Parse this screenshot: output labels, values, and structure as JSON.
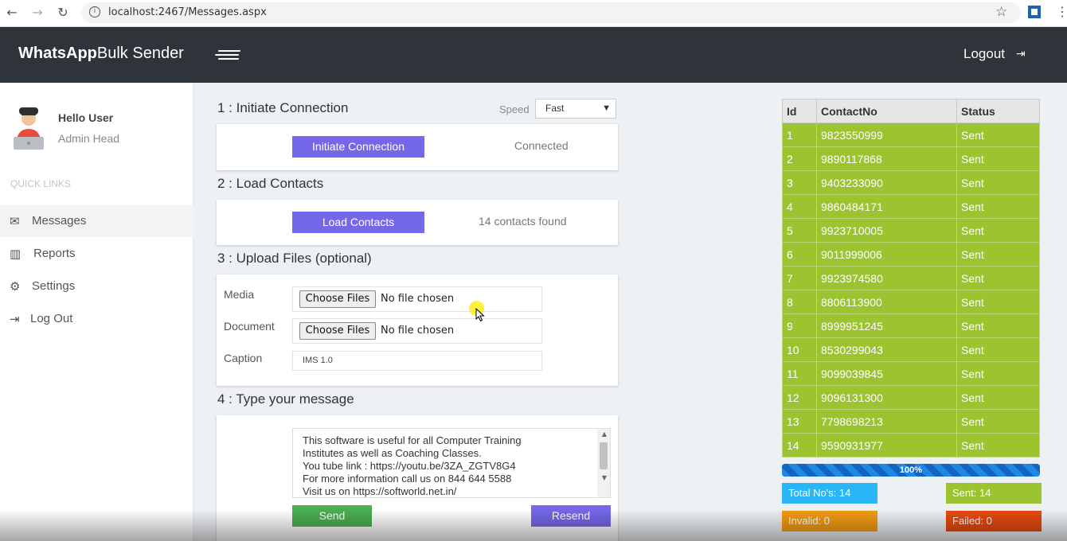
{
  "browser": {
    "url": "localhost:2467/Messages.aspx",
    "back_icon": "←",
    "forward_icon": "→",
    "reload_icon": "↻",
    "info_icon": "i",
    "star_icon": "☆",
    "kebab_icon": "⋮"
  },
  "header": {
    "brand_bold": "WhatsApp",
    "brand_rest": "Bulk Sender",
    "logout_label": "Logout",
    "logout_icon": "⇥"
  },
  "sidebar": {
    "greeting": "Hello User",
    "role": "Admin Head",
    "quick_links_label": "QUICK LINKS",
    "items": [
      {
        "label": "Messages",
        "icon": "✉"
      },
      {
        "label": "Reports",
        "icon": "▥"
      },
      {
        "label": "Settings",
        "icon": "⚙"
      },
      {
        "label": "Log Out",
        "icon": "⇥"
      }
    ]
  },
  "step1": {
    "title": "1 : Initiate Connection",
    "speed_label": "Speed",
    "speed_value": "Fast",
    "button_label": "Initiate Connection",
    "status": "Connected"
  },
  "step2": {
    "title": "2 : Load Contacts",
    "button_label": "Load Contacts",
    "status": "14 contacts found"
  },
  "step3": {
    "title": "3 : Upload Files (optional)",
    "media_label": "Media",
    "document_label": "Document",
    "caption_label": "Caption",
    "choose_label": "Choose Files",
    "no_file_text": "No file chosen",
    "caption_value": "IMS 1.0"
  },
  "step4": {
    "title": "4 : Type your message",
    "message_lines": [
      "This software is useful for all Computer Training",
      "Institutes as well as Coaching Classes.",
      "You tube link : https://youtu.be/3ZA_ZGTV8G4",
      "For more information call us on 844 644 5588",
      "Visit us on https://softworld.net.in/"
    ],
    "send_label": "Send",
    "resend_label": "Resend"
  },
  "table": {
    "headers": [
      "Id",
      "ContactNo",
      "Status"
    ],
    "rows": [
      [
        "1",
        "9823550999",
        "Sent"
      ],
      [
        "2",
        "9890117868",
        "Sent"
      ],
      [
        "3",
        "9403233090",
        "Sent"
      ],
      [
        "4",
        "9860484171",
        "Sent"
      ],
      [
        "5",
        "9923710005",
        "Sent"
      ],
      [
        "6",
        "9011999006",
        "Sent"
      ],
      [
        "7",
        "9923974580",
        "Sent"
      ],
      [
        "8",
        "8806113900",
        "Sent"
      ],
      [
        "9",
        "8999951245",
        "Sent"
      ],
      [
        "10",
        "8530299043",
        "Sent"
      ],
      [
        "11",
        "9099039845",
        "Sent"
      ],
      [
        "12",
        "9096131300",
        "Sent"
      ],
      [
        "13",
        "7798698213",
        "Sent"
      ],
      [
        "14",
        "9590931977",
        "Sent"
      ]
    ]
  },
  "progress": {
    "label": "100%",
    "fraction": 1.0
  },
  "stats": {
    "total": "Total No's: 14",
    "sent": "Sent: 14",
    "invalid": "Invalid: 0",
    "failed": "Failed: 0"
  },
  "colors": {
    "header_bg": "#2f343a",
    "accent": "#7468e8",
    "row_green": "#9cc330",
    "send_green": "#4caf50",
    "total_blue": "#29b6f6",
    "invalid_orange": "#f39c12",
    "failed_red": "#e8490f"
  }
}
